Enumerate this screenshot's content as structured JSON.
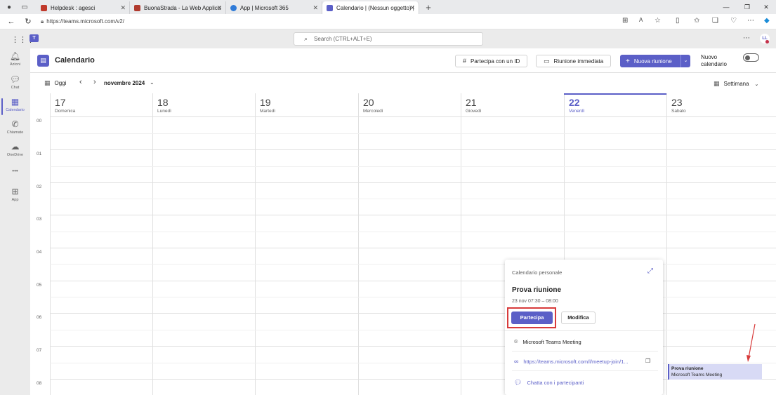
{
  "browser": {
    "tabs": [
      {
        "title": "Helpdesk : agesci",
        "favicon_color": "#c0392b"
      },
      {
        "title": "BuonaStrada - La Web Application",
        "favicon_color": "#b03a2e"
      },
      {
        "title": "App | Microsoft 365",
        "favicon_color": "#2f7bd8"
      },
      {
        "title": "Calendario | (Nessun oggetto) | M",
        "favicon_color": "#5b5fc7"
      }
    ],
    "url": "https://teams.microsoft.com/v2/"
  },
  "teams": {
    "search_placeholder": "Search (CTRL+ALT+E)",
    "avatar_initials": "LL"
  },
  "rail": [
    {
      "label": "Azioni",
      "icon": "bell-icon",
      "glyph": "🔔︎"
    },
    {
      "label": "Chat",
      "icon": "chat-icon",
      "glyph": "💬︎"
    },
    {
      "label": "Calendario",
      "icon": "calendar-icon",
      "glyph": "▦",
      "active": true
    },
    {
      "label": "Chiamate",
      "icon": "phone-icon",
      "glyph": "✆"
    },
    {
      "label": "OneDrive",
      "icon": "cloud-icon",
      "glyph": "☁"
    },
    {
      "label": "",
      "icon": "more-icon",
      "glyph": "•••"
    },
    {
      "label": "App",
      "icon": "apps-icon",
      "glyph": "⊞"
    }
  ],
  "header": {
    "title": "Calendario",
    "join_id": "Partecipa con un ID",
    "meet_now": "Riunione immediata",
    "new_meeting": "Nuova riunione",
    "new_calendar_1": "Nuovo",
    "new_calendar_2": "calendario"
  },
  "toolbar": {
    "today": "Oggi",
    "month": "novembre 2024",
    "view": "Settimana"
  },
  "days": [
    {
      "num": "17",
      "name": "Domenica"
    },
    {
      "num": "18",
      "name": "Lunedì"
    },
    {
      "num": "19",
      "name": "Martedì"
    },
    {
      "num": "20",
      "name": "Mercoledì"
    },
    {
      "num": "21",
      "name": "Giovedì"
    },
    {
      "num": "22",
      "name": "Venerdì",
      "today": true
    },
    {
      "num": "23",
      "name": "Sabato"
    }
  ],
  "hours": [
    "00",
    "01",
    "02",
    "03",
    "04",
    "05",
    "06",
    "07",
    "08"
  ],
  "event": {
    "title": "Prova riunione",
    "subtitle": "Microsoft Teams Meeting"
  },
  "popup": {
    "calendar": "Calendario personale",
    "title": "Prova riunione",
    "time": "23 nov 07:30 – 08:00",
    "join": "Partecipa",
    "edit": "Modifica",
    "location": "Microsoft Teams Meeting",
    "link": "https://teams.microsoft.com/l/meetup-join/1...",
    "chat": "Chatta con i partecipanti"
  },
  "colors": {
    "accent": "#5b5fc7",
    "annotation": "#d83b3b"
  }
}
